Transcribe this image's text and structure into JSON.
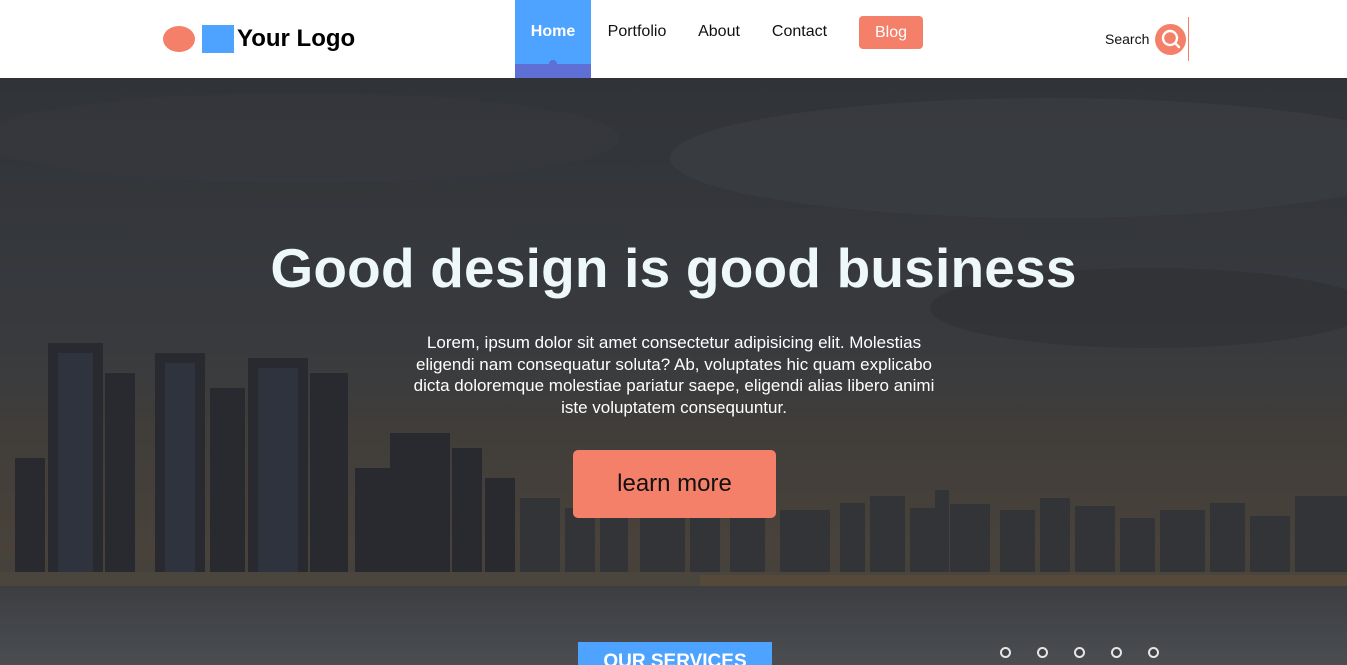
{
  "header": {
    "logo_text": "Your Logo",
    "nav": {
      "home": "Home",
      "portfolio": "Portfolio",
      "about": "About",
      "contact": "Contact",
      "blog": "Blog"
    },
    "search_label": "Search"
  },
  "hero": {
    "title": "Good design is good business",
    "text": "Lorem, ipsum dolor sit amet consectetur adipisicing elit. Molestias eligendi nam consequatur soluta? Ab, voluptates hic quam explicabo dicta doloremque molestiae pariatur saepe, eligendi alias libero animi iste voluptatem consequuntur.",
    "cta_label": "learn more",
    "services_label": "OUR SERVICES",
    "carousel_dots": 5
  },
  "colors": {
    "accent_coral": "#f5806a",
    "accent_blue": "#4da3ff",
    "nav_indicator": "#5e6fd6",
    "header_bg": "#ffffff"
  },
  "icons": {
    "search": "search-icon",
    "logo_circle": "logo-circle-icon",
    "logo_square": "logo-square-icon"
  }
}
